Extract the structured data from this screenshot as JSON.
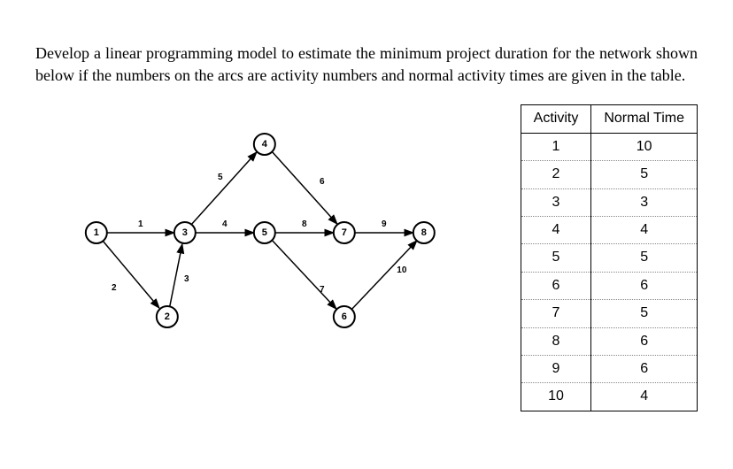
{
  "problem_text": "Develop a linear programming model to estimate the minimum project duration for the network shown below if the numbers on the arcs are activity numbers and normal activity times are given in the table.",
  "table": {
    "headers": {
      "col1": "Activity",
      "col2": "Normal Time"
    },
    "rows": [
      {
        "activity": "1",
        "time": "10"
      },
      {
        "activity": "2",
        "time": "5"
      },
      {
        "activity": "3",
        "time": "3"
      },
      {
        "activity": "4",
        "time": "4"
      },
      {
        "activity": "5",
        "time": "5"
      },
      {
        "activity": "6",
        "time": "6"
      },
      {
        "activity": "7",
        "time": "5"
      },
      {
        "activity": "8",
        "time": "6"
      },
      {
        "activity": "9",
        "time": "6"
      },
      {
        "activity": "10",
        "time": "4"
      }
    ]
  },
  "diagram": {
    "nodes": {
      "n1": "1",
      "n2": "2",
      "n3": "3",
      "n4": "4",
      "n5": "5",
      "n6": "6",
      "n7": "7",
      "n8": "8"
    },
    "arcs": {
      "a1": "1",
      "a2": "2",
      "a3": "3",
      "a4": "4",
      "a5": "5",
      "a6": "6",
      "a7": "7",
      "a8": "8",
      "a9": "9",
      "a10": "10"
    }
  },
  "chart_data": {
    "type": "table",
    "title": "Activity Normal Times",
    "columns": [
      "Activity",
      "Normal Time"
    ],
    "rows": [
      [
        1,
        10
      ],
      [
        2,
        5
      ],
      [
        3,
        3
      ],
      [
        4,
        4
      ],
      [
        5,
        5
      ],
      [
        6,
        6
      ],
      [
        7,
        5
      ],
      [
        8,
        6
      ],
      [
        9,
        6
      ],
      [
        10,
        4
      ]
    ],
    "network": {
      "nodes": [
        1,
        2,
        3,
        4,
        5,
        6,
        7,
        8
      ],
      "arcs": [
        {
          "id": 1,
          "from": 1,
          "to": 3
        },
        {
          "id": 2,
          "from": 1,
          "to": 2
        },
        {
          "id": 3,
          "from": 2,
          "to": 3
        },
        {
          "id": 4,
          "from": 3,
          "to": 5
        },
        {
          "id": 5,
          "from": 3,
          "to": 4
        },
        {
          "id": 6,
          "from": 4,
          "to": 7
        },
        {
          "id": 7,
          "from": 5,
          "to": 6
        },
        {
          "id": 8,
          "from": 5,
          "to": 7
        },
        {
          "id": 9,
          "from": 7,
          "to": 8
        },
        {
          "id": 10,
          "from": 6,
          "to": 8
        }
      ]
    }
  }
}
